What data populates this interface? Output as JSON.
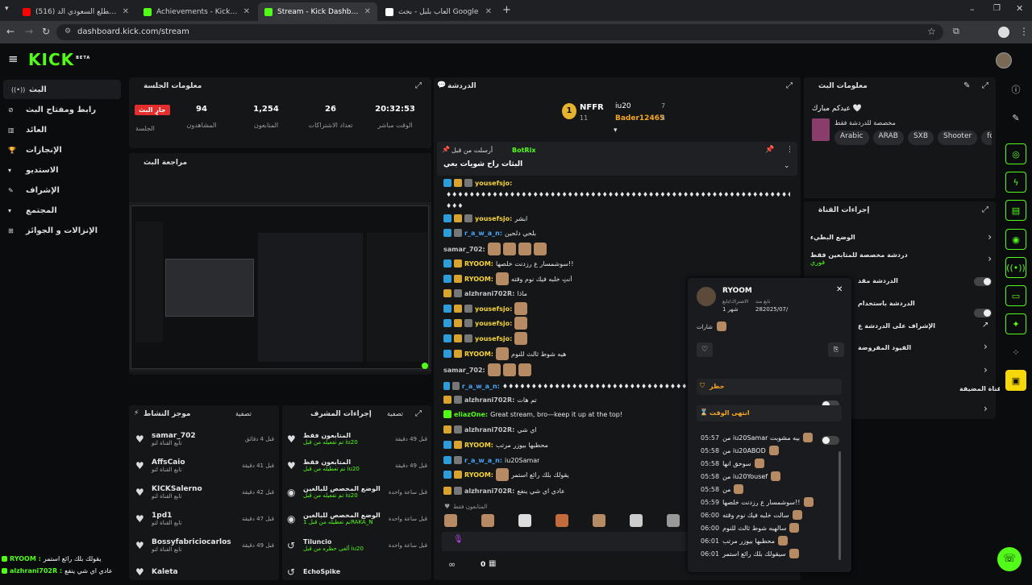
{
  "browser": {
    "tabs": [
      {
        "title": "(516) هل تقدر تطلع السعودي الد...",
        "favicon_color": "#ff0000"
      },
      {
        "title": "Achievements - Kick Dashboard",
        "favicon_color": "#53fc18"
      },
      {
        "title": "Stream - Kick Dashboard",
        "favicon_color": "#53fc18"
      },
      {
        "title": "العاب بلبل - بحث Google",
        "favicon_color": "#ffffff"
      }
    ],
    "url": "dashboard.kick.com/stream"
  },
  "brand": {
    "logo": "KICK",
    "beta": "BETA",
    "accent": "#53fc18"
  },
  "sidebar": {
    "items": [
      {
        "label": "البث",
        "icon": "broadcast-icon"
      },
      {
        "label": "رابط ومفتاح البث",
        "icon": "link-icon"
      },
      {
        "label": "العائد",
        "icon": "chart-icon"
      },
      {
        "label": "الإنجازات",
        "icon": "trophy-icon"
      },
      {
        "label": "الاستديو",
        "icon": "studio-icon"
      },
      {
        "label": "الإشراف",
        "icon": "wrench-icon"
      },
      {
        "label": "المجتمع",
        "icon": "community-icon"
      },
      {
        "label": "الإنزالات و الجوائز",
        "icon": "gift-icon"
      }
    ]
  },
  "session": {
    "title": "معلومات الجلسة",
    "live_badge": "جارٍ البث",
    "live_label": "الجلسة",
    "stats": [
      {
        "value": "94",
        "label": "المشاهدون"
      },
      {
        "value": "1,254",
        "label": "المتابعون"
      },
      {
        "value": "26",
        "label": "تعداد الاشتراكات"
      },
      {
        "value": "20:32:53",
        "label": "الوقت مباشر"
      }
    ]
  },
  "preview": {
    "title": "مراجعة البث"
  },
  "activity": {
    "title": "موجز النشاط",
    "filter": "تصفية",
    "items": [
      {
        "name": "samar_702",
        "sub": "تابع القناة لتو",
        "time": "قبل 4 دقائق"
      },
      {
        "name": "AffsCaio",
        "sub": "تابع القناة لتو",
        "time": "قبل 41 دقيقة"
      },
      {
        "name": "KICKSalerno",
        "sub": "تابع القناة لتو",
        "time": "قبل 42 دقيقة"
      },
      {
        "name": "1pd1",
        "sub": "تابع القناة لتو",
        "time": "قبل 47 دقيقة"
      },
      {
        "name": "Bossyfabriciocarlos",
        "sub": "تابع القناة لتو",
        "time": "قبل 49 دقيقة"
      },
      {
        "name": "Kaleta",
        "sub": "",
        "time": ""
      }
    ]
  },
  "modactions": {
    "title": "إجراءات المشرف",
    "filter": "تصفية",
    "items": [
      {
        "name": "المتابعون فقط",
        "sub": "تم تفعيله من قبل iu20",
        "time": "قبل 49 دقيقة"
      },
      {
        "name": "المتابعون فقط",
        "sub": "تم تعطيله من قبل iu20",
        "time": "قبل 49 دقيقة"
      },
      {
        "name": "الوضع المخصص للبالغين",
        "sub": "تم تفعيله من قبل iu20",
        "time": "قبل ساعة واحدة"
      },
      {
        "name": "الوضع المخصص للبالغين",
        "sub": "تم تعطيله من قبل 1RAKA_N",
        "time": "قبل ساعة واحدة"
      },
      {
        "name": "Tiluncio",
        "sub": "ألغى حظره من قبل iu20",
        "time": "قبل ساعة واحدة"
      },
      {
        "name": "EchoSpike",
        "sub": "",
        "time": ""
      }
    ]
  },
  "chat": {
    "title": "الدردشة",
    "leaderboard": {
      "first_name": "NFFR",
      "first_count": "11",
      "second_name": "iu20",
      "second_count": "7",
      "third_name": "Bader12465",
      "third_count": "4"
    },
    "pinned": {
      "by": "أرسلت من قبل",
      "author": "BotRix",
      "text": "البثات راح شويات بعي"
    },
    "messages": [
      {
        "user": "yousefsjo:",
        "cls": "un-y",
        "badges": [
          "bg-blue",
          "bg-gold",
          "bg-gray"
        ],
        "text": "",
        "emotes": 0
      },
      {
        "user": "",
        "cls": "un-y",
        "badges": [],
        "text": "♦♦♦♦♦♦♦♦♦♦♦♦♦♦♦♦♦♦♦♦♦♦♦♦♦♦♦♦♦♦♦♦♦♦♦♦♦♦♦♦♦♦♦♦♦♦♦♦♦♦♦♦♦♦♦♦♦♦♦♦♦♦♦♦♦♦♦♦♦♦",
        "emotes": 0
      },
      {
        "user": "",
        "cls": "un-y",
        "badges": [],
        "text": "♦♦♦",
        "emotes": 0
      },
      {
        "user": "yousefsjo:",
        "cls": "un-y",
        "badges": [
          "bg-blue",
          "bg-gold",
          "bg-gray"
        ],
        "text": "ابشر",
        "emotes": 0
      },
      {
        "user": "r_a_w_a_n:",
        "cls": "un-b",
        "badges": [
          "bg-blue",
          "bg-gray"
        ],
        "text": "بلحي دلحين",
        "emotes": 0
      },
      {
        "user": "samar_702:",
        "cls": "un-r",
        "badges": [],
        "text": "",
        "emotes": 4
      },
      {
        "user": "RYOOM:",
        "cls": "un-y",
        "badges": [
          "bg-blue",
          "bg-gold"
        ],
        "text": "سوشمسار ع رزدنت خلصها!!",
        "emotes": 0
      },
      {
        "user": "RYOOM:",
        "cls": "un-y",
        "badges": [
          "bg-blue",
          "bg-gold"
        ],
        "text": "أنتِ خلبه فيك نوم وقته",
        "emotes": 1
      },
      {
        "user": "alzhrani702R:",
        "cls": "un-r",
        "badges": [
          "bg-gold",
          "bg-gray"
        ],
        "text": "ماذا",
        "emotes": 0
      },
      {
        "user": "yousefsjo:",
        "cls": "un-y",
        "badges": [
          "bg-blue",
          "bg-gold",
          "bg-gray"
        ],
        "text": "",
        "emotes": 1
      },
      {
        "user": "yousefsjo:",
        "cls": "un-y",
        "badges": [
          "bg-blue",
          "bg-gold",
          "bg-gray"
        ],
        "text": "",
        "emotes": 1
      },
      {
        "user": "yousefsjo:",
        "cls": "un-y",
        "badges": [
          "bg-blue",
          "bg-gold",
          "bg-gray"
        ],
        "text": "",
        "emotes": 1
      },
      {
        "user": "RYOOM:",
        "cls": "un-y",
        "badges": [
          "bg-blue",
          "bg-gold"
        ],
        "text": "هيه شوط ثالث للنوم",
        "emotes": 1
      },
      {
        "user": "samar_702:",
        "cls": "un-r",
        "badges": [],
        "text": "",
        "emotes": 3
      },
      {
        "user": "r_a_w_a_n:",
        "cls": "un-b",
        "badges": [
          "bg-blue",
          "bg-gray"
        ],
        "text": "♦♦♦♦♦♦♦♦♦♦♦♦♦♦♦♦♦♦♦♦♦♦♦♦♦♦♦♦♦♦♦♦♦♦♦♦♦♦♦♦♦♦♦♦♦♦♦♦♦♦♦♦♦♦♦♦♦♦♦",
        "emotes": 0
      },
      {
        "user": "alzhrani702R:",
        "cls": "un-r",
        "badges": [
          "bg-gold",
          "bg-gray"
        ],
        "text": "تم هات",
        "emotes": 0
      },
      {
        "user": "eliazOne:",
        "cls": "un-g",
        "badges": [
          "bg-green"
        ],
        "text": "Great stream, bro—keep it up at the top!",
        "emotes": 0
      },
      {
        "user": "alzhrani702R:",
        "cls": "un-r",
        "badges": [
          "bg-gold",
          "bg-gray"
        ],
        "text": "اي شي",
        "emotes": 0
      },
      {
        "user": "RYOOM:",
        "cls": "un-y",
        "badges": [
          "bg-blue",
          "bg-gold"
        ],
        "text": "محطبها بيوزر مرتب",
        "emotes": 0
      },
      {
        "user": "r_a_w_a_n:",
        "cls": "un-b",
        "badges": [
          "bg-blue",
          "bg-gray"
        ],
        "text": "iu20Samar",
        "emotes": 0
      },
      {
        "user": "RYOOM:",
        "cls": "un-y",
        "badges": [
          "bg-blue",
          "bg-gold"
        ],
        "text": "يقولك بلك رائع استمر",
        "emotes": 1
      },
      {
        "user": "alzhrani702R:",
        "cls": "un-r",
        "badges": [
          "bg-gold",
          "bg-gray"
        ],
        "text": "عادي اي شي ينفع",
        "emotes": 0
      }
    ],
    "followers_only": "المتابعون فقط",
    "footer_count": "0"
  },
  "stream_info": {
    "title": "معلومات البث",
    "stream_title": "عيدكم مبارك 🤍",
    "desc": "مخصصة للدردشة فقط",
    "tags": [
      "Arabic",
      "ARAB",
      "SXB",
      "Shooter",
      "fortnr"
    ]
  },
  "channel_actions": {
    "title": "إجراءات القناة",
    "items": [
      {
        "label": "الوضع البطيء"
      },
      {
        "label": "دردشة مخصصة للمتابعين فقط",
        "sub": "فوري"
      },
      {
        "label": "الدردشة مقد"
      },
      {
        "label": "الدردشة باستخدام"
      },
      {
        "label": "الإشراف على الدردشة ع"
      },
      {
        "label": "القيود المفروضة"
      },
      {
        "label": ""
      },
      {
        "label": "القناة المضيفة"
      }
    ]
  },
  "usercard": {
    "name": "RYOOM",
    "sub_label": "الاشتراك/تابع",
    "sub_months": "1 شهر",
    "follow_label": "تابع منذ",
    "follow_date": "282025/07/",
    "badges_label": "شارات",
    "ban": "حظر",
    "timeout": "انتهى الوقت",
    "history": [
      {
        "time": "05:57",
        "text": "من iu20Samar بيه مشوبت"
      },
      {
        "time": "05:58",
        "text": "من iu20ABOD"
      },
      {
        "time": "05:58",
        "text": "سوحق انها"
      },
      {
        "time": "05:58",
        "text": "من iu20Yousef"
      },
      {
        "time": "05:58",
        "text": "من"
      },
      {
        "time": "05:59",
        "text": "سوشمسار ع رزدنت خلصها!!"
      },
      {
        "time": "06:00",
        "text": "سالت خلبه فيك نوم وقته"
      },
      {
        "time": "06:00",
        "text": "سالهبه شوط ثالث للنوم"
      },
      {
        "time": "06:01",
        "text": "محطبها بيوزر مرتب"
      },
      {
        "time": "06:01",
        "text": "سيقولك بلك رائع استمر"
      }
    ]
  },
  "bottom_feed": [
    {
      "user": "RYOOM :",
      "text": "يقولك بلك رائع استمر"
    },
    {
      "user": "alzhrani702R :",
      "text": "عادي اي شي ينفع"
    }
  ]
}
